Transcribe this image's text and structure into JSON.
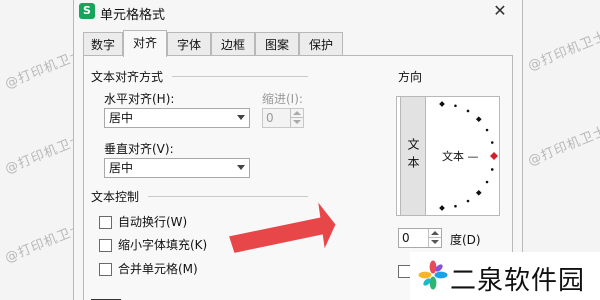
{
  "background_watermark": "@打印机卫士",
  "dialog": {
    "app_icon": "S",
    "title": "单元格格式",
    "close_glyph": "✕"
  },
  "tabs": [
    {
      "label": "数字",
      "active": false
    },
    {
      "label": "对齐",
      "active": true
    },
    {
      "label": "字体",
      "active": false
    },
    {
      "label": "边框",
      "active": false
    },
    {
      "label": "图案",
      "active": false
    },
    {
      "label": "保护",
      "active": false
    }
  ],
  "alignment": {
    "section_title": "文本对齐方式",
    "horizontal_label": "水平对齐(H):",
    "horizontal_value": "居中",
    "indent_label": "缩进(I):",
    "indent_value": "0",
    "vertical_label": "垂直对齐(V):",
    "vertical_value": "居中"
  },
  "text_control": {
    "section_title": "文本控制",
    "wrap_label": "自动换行(W)",
    "shrink_label": "缩小字体填充(K)",
    "merge_label": "合并单元格(M)",
    "wrap_checked": false,
    "shrink_checked": false,
    "merge_checked": false
  },
  "orientation": {
    "title": "方向",
    "vertical_text": "文本",
    "dial_text": "文本 —",
    "degree_value": "0",
    "degree_label": "度(D)"
  },
  "brand": {
    "name": "二泉软件园"
  },
  "colors": {
    "annotation_arrow": "#e8474a",
    "dial_marker": "#d0202a",
    "app_icon_bg": "#19a45c"
  }
}
